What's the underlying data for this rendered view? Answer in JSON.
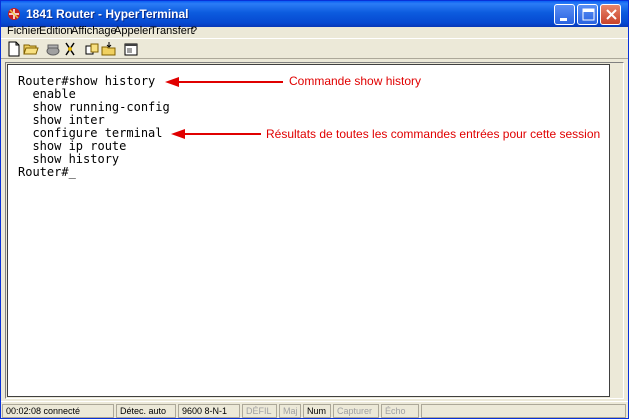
{
  "window": {
    "title": "1841 Router - HyperTerminal"
  },
  "menu": [
    "Fichier",
    "Edition",
    "Affichage",
    "Appeler",
    "Transfert",
    "?"
  ],
  "toolbar": {
    "icons": [
      "new-document-icon",
      "open-folder-icon",
      "phone-icon",
      "disconnect-icon",
      "send-icon",
      "receive-icon",
      "properties-icon"
    ]
  },
  "terminal": {
    "lines": [
      "Router#show history",
      "  enable",
      "  show running-config",
      "  show inter",
      "  configure terminal",
      "  show ip route",
      "  show history",
      "Router#_"
    ]
  },
  "annotations": {
    "first": "Commande show history",
    "second": "Résultats de toutes les commandes entrées pour cette session"
  },
  "statusbar": {
    "time": "00:02:08 connecté",
    "detect": "Détec. auto",
    "params": "9600 8-N-1",
    "scroll": "DÉFIL",
    "caps": "Maj",
    "num": "Num",
    "capture": "Capturer",
    "echo": "Écho"
  },
  "colors": {
    "annotation": "#e00000",
    "titlebar": "#0c5bde"
  }
}
